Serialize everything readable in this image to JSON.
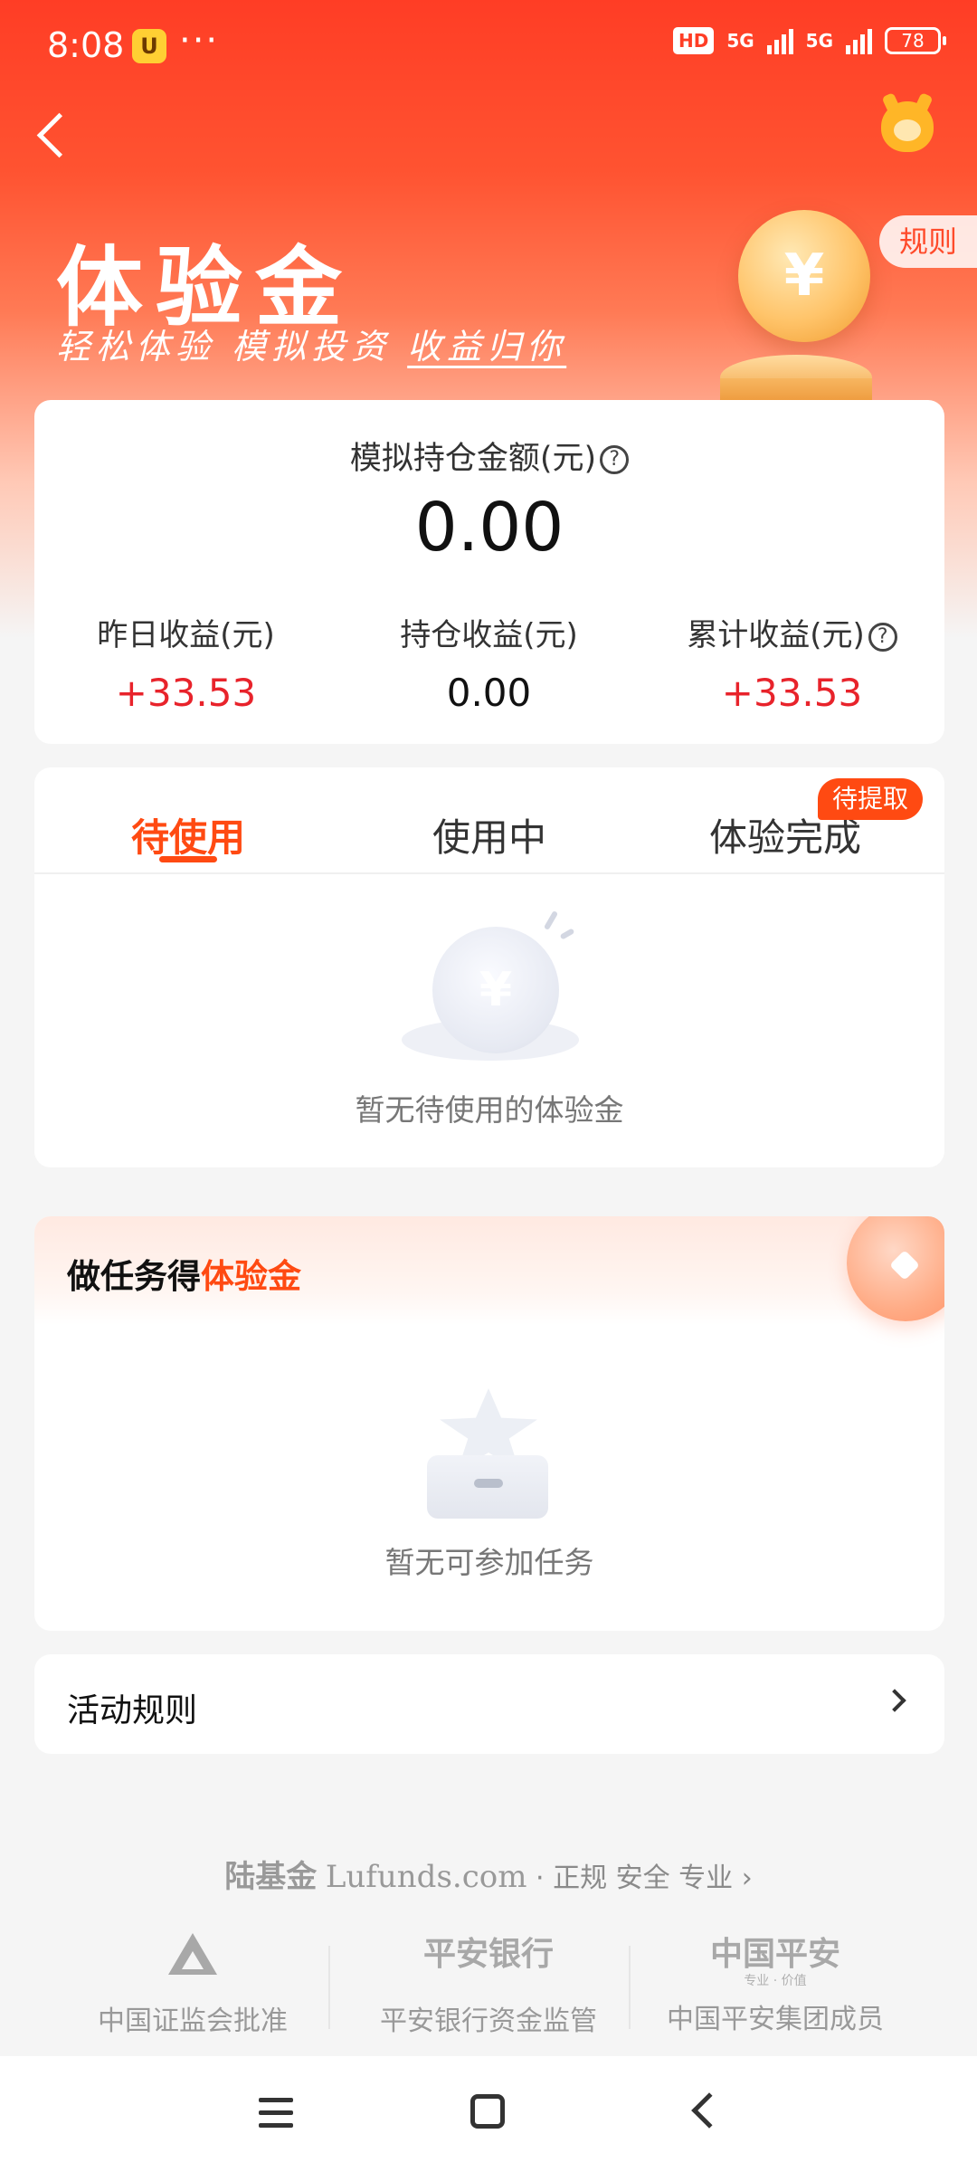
{
  "status_bar": {
    "time": "8:08",
    "more": "···",
    "hd": "HD",
    "net1": "5G",
    "net2": "5G",
    "battery": "78"
  },
  "hero": {
    "title": "体验金",
    "subtitle": "轻松体验  模拟投资  ",
    "subtitle_highlight": "收益归你",
    "rules_button": "规则"
  },
  "summary": {
    "label": "模拟持仓金额(元)",
    "help_icon": "?",
    "value": "0.00",
    "stats": [
      {
        "label": "昨日收益(元)",
        "value": "+33.53",
        "color": "#e8232b"
      },
      {
        "label": "持仓收益(元)",
        "value": "0.00",
        "color": "#111111"
      },
      {
        "label": "累计收益(元)",
        "value": "+33.53",
        "color": "#e8232b"
      }
    ]
  },
  "tabs": {
    "items": [
      {
        "label": "待使用",
        "active": true
      },
      {
        "label": "使用中",
        "active": false
      },
      {
        "label": "体验完成",
        "active": false
      }
    ],
    "badge": "待提取",
    "empty_text": "暂无待使用的体验金"
  },
  "tasks": {
    "title_prefix": "做任务得",
    "title_highlight": "体验金",
    "empty_text": "暂无可参加任务"
  },
  "activity_rules": {
    "label": "活动规则"
  },
  "footer": {
    "brand_cn": "陆基金",
    "brand_en": "Lufunds.com",
    "tagline": " · 正规 安全 专业 ›",
    "columns": [
      {
        "logo": "",
        "text": "中国证监会批准"
      },
      {
        "logo": "平安银行",
        "text": "平安银行资金监管"
      },
      {
        "logo": "中国平安",
        "logo_sub": "专业 · 价值",
        "text": "中国平安集团成员"
      }
    ]
  },
  "colors": {
    "brand": "#ff3d25",
    "accent": "#ff4a12",
    "gain": "#e8232b"
  },
  "icons": [
    "back-icon",
    "mascot-icon",
    "help-icon",
    "coin-icon",
    "chevron-right-icon",
    "menu-icon",
    "home-icon",
    "nav-back-icon"
  ]
}
